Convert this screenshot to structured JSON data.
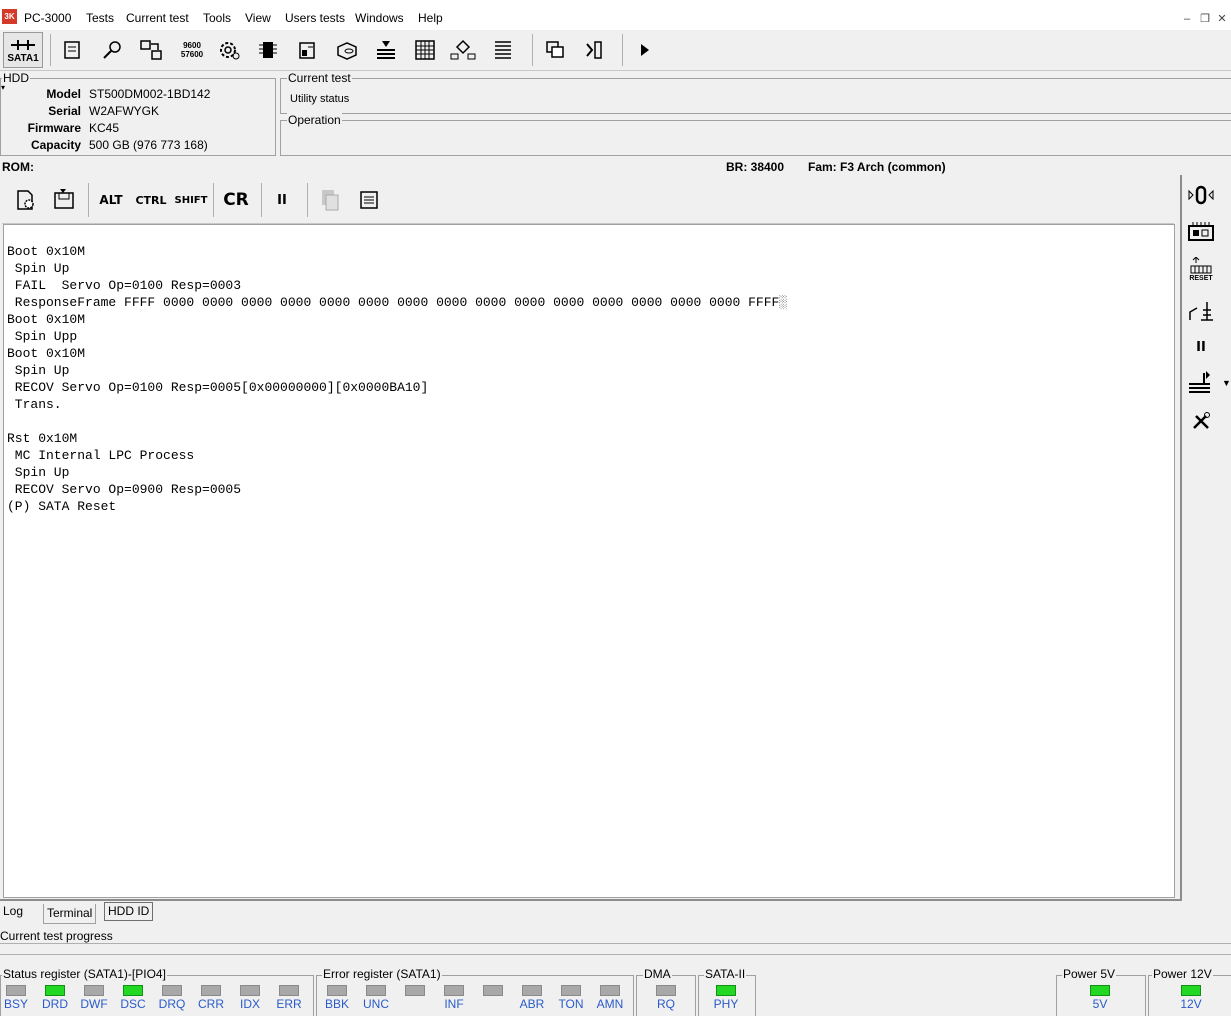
{
  "app": {
    "title": "PC-3000",
    "logo_text": "3K"
  },
  "menu": [
    "Tests",
    "Current test",
    "Tools",
    "View",
    "Users tests",
    "Windows",
    "Help"
  ],
  "toolbar": {
    "port_label": "SATA1",
    "speed_top": "9600",
    "speed_bottom": "57600"
  },
  "hdd": {
    "title": "HDD",
    "fields": [
      {
        "label": "Model",
        "value": "ST500DM002-1BD142"
      },
      {
        "label": "Serial",
        "value": "W2AFWYGK"
      },
      {
        "label": "Firmware",
        "value": "KC45"
      },
      {
        "label": "Capacity",
        "value": "500 GB (976 773 168)"
      }
    ]
  },
  "current_test": {
    "title": "Current test",
    "status": "Utility status"
  },
  "operation": {
    "title": "Operation"
  },
  "status_line": {
    "rom": "ROM:",
    "br": "BR: 38400",
    "fam": "Fam: F3 Arch (common)"
  },
  "terminal_toolbar": {
    "alt": "ALT",
    "ctrl": "CTRL",
    "shift": "SHIFT",
    "cr": "CR",
    "pause": "II"
  },
  "terminal": {
    "lines": [
      "Boot 0x10M",
      " Spin Up",
      " FAIL  Servo Op=0100 Resp=0003",
      " ResponseFrame FFFF 0000 0000 0000 0000 0000 0000 0000 0000 0000 0000 0000 0000 0000 0000 0000 FFFF░",
      "Boot 0x10M",
      " Spin Upp",
      "Boot 0x10M",
      " Spin Up",
      " RECOV Servo Op=0100 Resp=0005[0x00000000][0x0000BA10]",
      " Trans.",
      "",
      "Rst 0x10M",
      " MC Internal LPC Process",
      " Spin Up",
      " RECOV Servo Op=0900 Resp=0005",
      "(P) SATA Reset"
    ]
  },
  "side_toolbar": {
    "reset_label": "RESET",
    "pause": "II"
  },
  "tabs": [
    {
      "label": "Log",
      "active": false
    },
    {
      "label": "Terminal",
      "active": true
    },
    {
      "label": "HDD ID",
      "active": false
    }
  ],
  "progress": {
    "label": "Current test progress"
  },
  "status_register": {
    "title": "Status register (SATA1)-[PIO4]",
    "leds": [
      {
        "label": "BSY",
        "on": false
      },
      {
        "label": "DRD",
        "on": true
      },
      {
        "label": "DWF",
        "on": false
      },
      {
        "label": "DSC",
        "on": true
      },
      {
        "label": "DRQ",
        "on": false
      },
      {
        "label": "CRR",
        "on": false
      },
      {
        "label": "IDX",
        "on": false
      },
      {
        "label": "ERR",
        "on": false
      }
    ]
  },
  "error_register": {
    "title": "Error register (SATA1)",
    "leds": [
      {
        "label": "BBK",
        "on": false
      },
      {
        "label": "UNC",
        "on": false
      },
      {
        "label": "",
        "on": false
      },
      {
        "label": "INF",
        "on": false
      },
      {
        "label": "",
        "on": false
      },
      {
        "label": "ABR",
        "on": false
      },
      {
        "label": "TON",
        "on": false
      },
      {
        "label": "AMN",
        "on": false
      }
    ]
  },
  "dma": {
    "title": "DMA",
    "label": "RQ",
    "on": false
  },
  "sata2": {
    "title": "SATA-II",
    "label": "PHY",
    "on": true
  },
  "power5": {
    "title": "Power 5V",
    "label": "5V",
    "on": true
  },
  "power12": {
    "title": "Power 12V",
    "label": "12V",
    "on": true
  },
  "colors": {
    "led_on": "#22d822",
    "led_off": "#a8a8a8",
    "led_label": "#2a5bc9",
    "logo": "#d43a2a"
  }
}
